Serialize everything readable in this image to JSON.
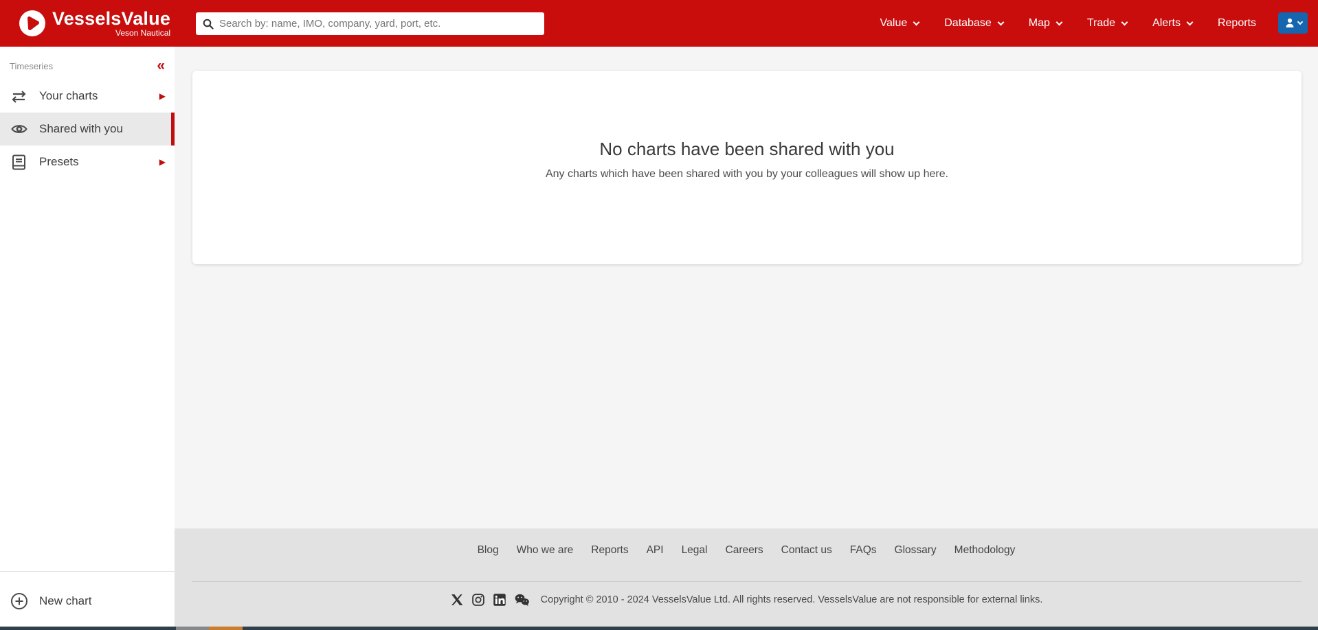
{
  "header": {
    "logo": {
      "title": "VesselsValue",
      "subtitle": "Veson Nautical"
    },
    "search": {
      "placeholder": "Search by: name, IMO, company, yard, port, etc.",
      "value": ""
    },
    "nav": [
      {
        "label": "Value",
        "dropdown": true
      },
      {
        "label": "Database",
        "dropdown": true
      },
      {
        "label": "Map",
        "dropdown": true
      },
      {
        "label": "Trade",
        "dropdown": true
      },
      {
        "label": "Alerts",
        "dropdown": true
      },
      {
        "label": "Reports",
        "dropdown": false
      }
    ]
  },
  "sidebar": {
    "section_title": "Timeseries",
    "collapse_icon": "«",
    "items": [
      {
        "label": "Your charts",
        "icon": "swap-arrows-icon",
        "has_submenu": true,
        "selected": false
      },
      {
        "label": "Shared with you",
        "icon": "eye-icon",
        "has_submenu": false,
        "selected": true
      },
      {
        "label": "Presets",
        "icon": "book-icon",
        "has_submenu": true,
        "selected": false
      }
    ],
    "submenu_arrow": "▶",
    "new_chart_label": "New chart"
  },
  "main": {
    "empty_state": {
      "title": "No charts have been shared with you",
      "description": "Any charts which have been shared with you by your colleagues will show up here."
    }
  },
  "footer": {
    "links": [
      "Blog",
      "Who we are",
      "Reports",
      "API",
      "Legal",
      "Careers",
      "Contact us",
      "FAQs",
      "Glossary",
      "Methodology"
    ],
    "social_icons": [
      "x-icon",
      "instagram-icon",
      "linkedin-icon",
      "wechat-icon"
    ],
    "copyright": "Copyright © 2010 - 2024 VesselsValue Ltd. All rights reserved. VesselsValue are not responsible for external links."
  },
  "colors": {
    "brand_red": "#c90d0d",
    "accent_red": "#c00d0d",
    "user_button_blue": "#1565af",
    "footer_bg": "#e2e2e2",
    "content_bg": "#f5f5f5"
  }
}
